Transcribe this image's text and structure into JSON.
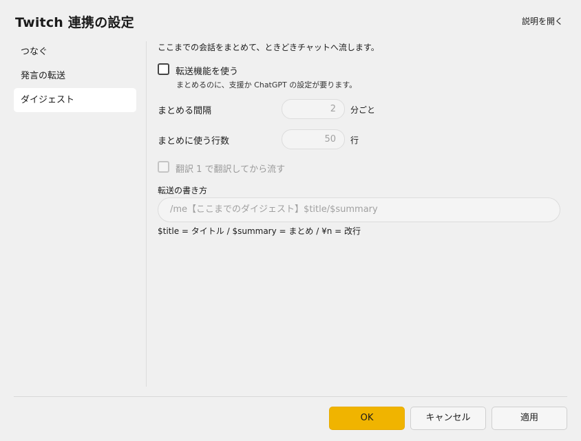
{
  "dialog": {
    "title": "Twitch 連携の設定",
    "help_link": "説明を開く"
  },
  "sidebar": {
    "items": [
      {
        "label": "つなぐ",
        "active": false
      },
      {
        "label": "発言の転送",
        "active": false
      },
      {
        "label": "ダイジェスト",
        "active": true
      }
    ]
  },
  "digest": {
    "description": "ここまでの会話をまとめて、ときどきチャットへ流します。",
    "enable_checkbox": {
      "label": "転送機能を使う",
      "checked": false
    },
    "enable_hint": "まとめるのに、支援か ChatGPT の設定が要ります。",
    "interval": {
      "label": "まとめる間隔",
      "value": "2",
      "unit": "分ごと"
    },
    "lines": {
      "label": "まとめに使う行数",
      "value": "50",
      "unit": "行"
    },
    "translate_checkbox": {
      "label": "翻訳 1 で翻訳してから流す",
      "checked": false,
      "disabled": true
    },
    "format": {
      "label": "転送の書き方",
      "placeholder": "/me【ここまでのダイジェスト】$title/$summary",
      "help": "$title = タイトル / $summary = まとめ / ¥n = 改行"
    }
  },
  "footer": {
    "ok_label": "OK",
    "cancel_label": "キャンセル",
    "apply_label": "適用"
  },
  "colors": {
    "accent": "#f0b400",
    "background": "#f0f0f0"
  }
}
